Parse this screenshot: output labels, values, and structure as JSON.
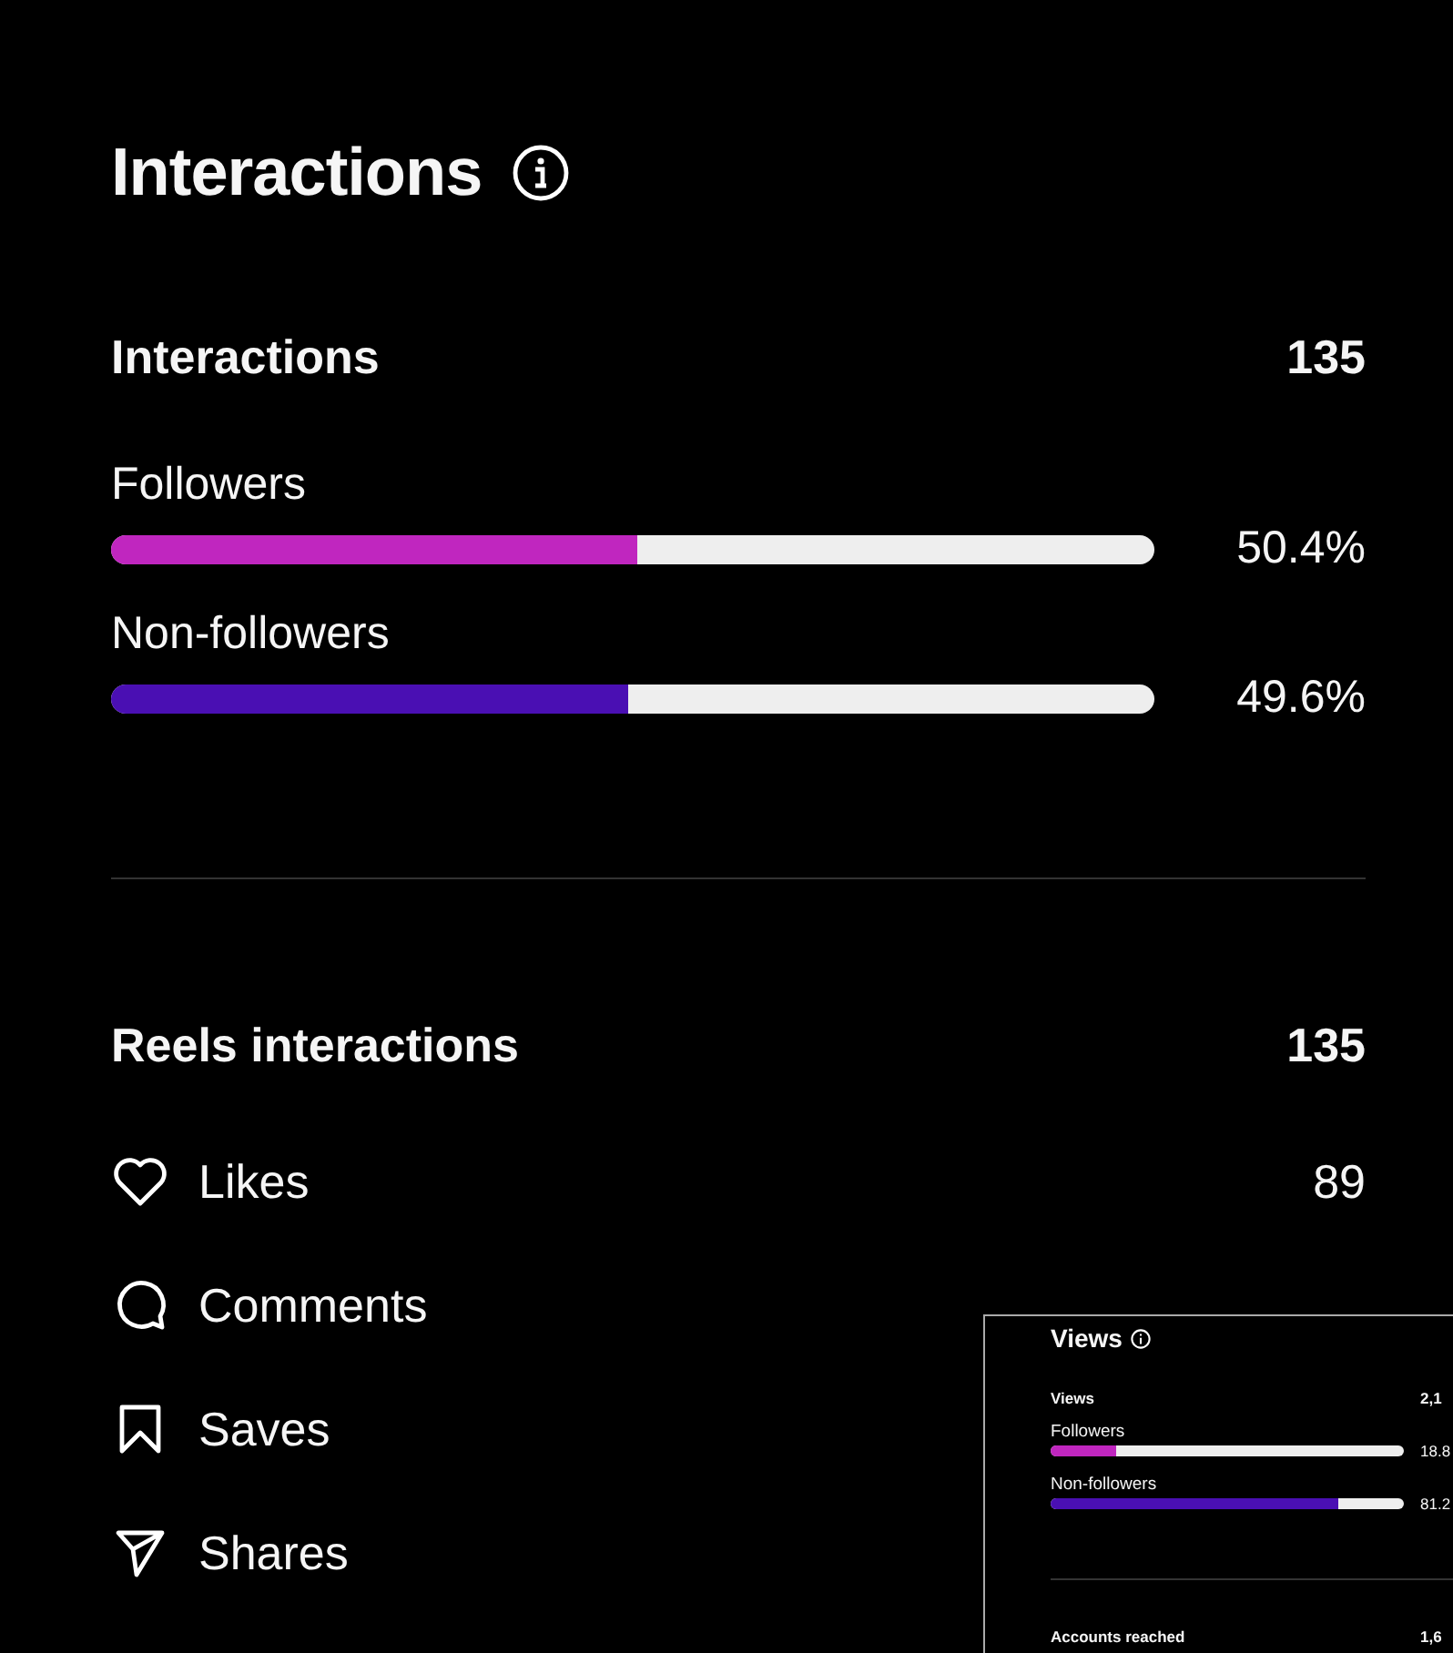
{
  "title": "Interactions",
  "summary": {
    "label": "Interactions",
    "value": "135"
  },
  "audience": [
    {
      "label": "Followers",
      "level": 0.504,
      "reading": "50.4%",
      "color": "#c026bf"
    },
    {
      "label": "Non-followers",
      "level": 0.496,
      "reading": "49.6%",
      "color": "#4a0fb3"
    }
  ],
  "reels": {
    "label": "Reels interactions",
    "value": "135"
  },
  "metrics": [
    {
      "kind": "likes",
      "label": "Likes",
      "value": "89"
    },
    {
      "kind": "comments",
      "label": "Comments"
    },
    {
      "kind": "saves",
      "label": "Saves"
    },
    {
      "kind": "shares",
      "label": "Shares"
    }
  ],
  "inset": {
    "title": "Views",
    "summary": {
      "label": "Views",
      "value": "2,1"
    },
    "audience": [
      {
        "label": "Followers",
        "level": 0.188,
        "reading": "18.8",
        "color": "#c026bf"
      },
      {
        "label": "Non-followers",
        "level": 0.812,
        "reading": "81.2",
        "color": "#4a0fb3"
      }
    ],
    "next": {
      "label": "Accounts reached",
      "value": "1,6"
    }
  }
}
